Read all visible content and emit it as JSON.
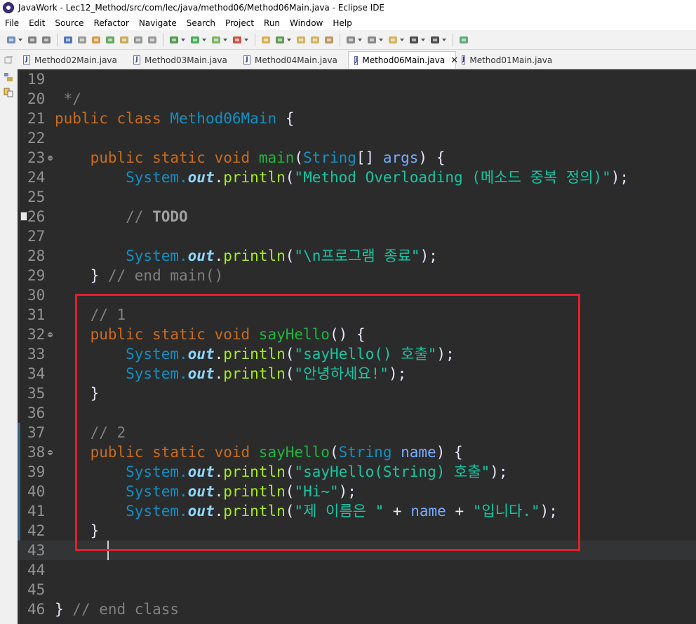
{
  "window": {
    "title": "JavaWork - Lec12_Method/src/com/lec/java/method06/Method06Main.java - Eclipse IDE"
  },
  "menu": [
    "File",
    "Edit",
    "Source",
    "Refactor",
    "Navigate",
    "Search",
    "Project",
    "Run",
    "Window",
    "Help"
  ],
  "toolbar_icons": [
    "new-icon",
    "save-icon",
    "save-all-icon",
    "terminal-icon",
    "skip-breakpoints-icon",
    "new-java-package-icon",
    "build-icon",
    "open-type-icon",
    "search-icon",
    "show-whitespace-icon",
    "debug-icon",
    "run-icon",
    "coverage-icon",
    "external-tools-icon",
    "new-class-icon",
    "refresh-icon",
    "open-folder-icon",
    "open-project-icon",
    "pen-icon",
    "next-annotation-icon",
    "prev-annotation-icon",
    "last-edit-icon",
    "back-icon",
    "forward-icon",
    "perspective-icon"
  ],
  "tabs": [
    {
      "label": "Method02Main.java",
      "active": false
    },
    {
      "label": "Method03Main.java",
      "active": false
    },
    {
      "label": "Method04Main.java",
      "active": false
    },
    {
      "label": "Method06Main.java",
      "active": true
    },
    {
      "label": "Method01Main.java",
      "active": false
    }
  ],
  "tab_close_glyph": "✕",
  "colors": {
    "editor_bg": "#2b2b2b",
    "keyword": "#cc6c1d",
    "class": "#1290c3",
    "string": "#17c6a3",
    "comment": "#808080",
    "method_decl": "#1eb540",
    "highlight_box": "#e0212a"
  },
  "editor": {
    "current_line": 43,
    "lines": [
      {
        "n": "19",
        "tokens": []
      },
      {
        "n": "20",
        "tokens": [
          {
            "t": " */",
            "c": "cm"
          }
        ]
      },
      {
        "n": "21",
        "tokens": [
          {
            "t": "public class ",
            "c": "kw"
          },
          {
            "t": "Method06Main",
            "c": "cls"
          },
          {
            "t": " {",
            "c": "pl"
          }
        ]
      },
      {
        "n": "22",
        "tokens": []
      },
      {
        "n": "23",
        "fold": true,
        "tokens": [
          {
            "t": "    public static void ",
            "c": "kw"
          },
          {
            "t": "main",
            "c": "mth"
          },
          {
            "t": "(",
            "c": "pl"
          },
          {
            "t": "String",
            "c": "cls"
          },
          {
            "t": "[] ",
            "c": "pl"
          },
          {
            "t": "args",
            "c": "prm"
          },
          {
            "t": ") {",
            "c": "pl"
          }
        ]
      },
      {
        "n": "24",
        "tokens": [
          {
            "t": "        System.",
            "c": "cls"
          },
          {
            "t": "out",
            "c": "fld"
          },
          {
            "t": ".",
            "c": "pl"
          },
          {
            "t": "println",
            "c": "callm"
          },
          {
            "t": "(",
            "c": "pl"
          },
          {
            "t": "\"Method Overloading (메소드 중복 정의)\"",
            "c": "str"
          },
          {
            "t": ");",
            "c": "pl"
          }
        ]
      },
      {
        "n": "25",
        "tokens": []
      },
      {
        "n": "26",
        "task": true,
        "tokens": [
          {
            "t": "        // ",
            "c": "cm"
          },
          {
            "t": "TODO",
            "c": "todo"
          }
        ]
      },
      {
        "n": "27",
        "tokens": []
      },
      {
        "n": "28",
        "tokens": [
          {
            "t": "        System.",
            "c": "cls"
          },
          {
            "t": "out",
            "c": "fld"
          },
          {
            "t": ".",
            "c": "pl"
          },
          {
            "t": "println",
            "c": "callm"
          },
          {
            "t": "(",
            "c": "pl"
          },
          {
            "t": "\"\\n프로그램 종료\"",
            "c": "str"
          },
          {
            "t": ");",
            "c": "pl"
          }
        ]
      },
      {
        "n": "29",
        "tokens": [
          {
            "t": "    } ",
            "c": "pl"
          },
          {
            "t": "// end main()",
            "c": "cm"
          }
        ]
      },
      {
        "n": "30",
        "tokens": []
      },
      {
        "n": "31",
        "tokens": [
          {
            "t": "    // 1",
            "c": "cm"
          }
        ]
      },
      {
        "n": "32",
        "fold": true,
        "tokens": [
          {
            "t": "    public static void ",
            "c": "kw"
          },
          {
            "t": "sayHello",
            "c": "mth"
          },
          {
            "t": "() {",
            "c": "pl"
          }
        ]
      },
      {
        "n": "33",
        "tokens": [
          {
            "t": "        System.",
            "c": "cls"
          },
          {
            "t": "out",
            "c": "fld"
          },
          {
            "t": ".",
            "c": "pl"
          },
          {
            "t": "println",
            "c": "callm"
          },
          {
            "t": "(",
            "c": "pl"
          },
          {
            "t": "\"sayHello() 호출\"",
            "c": "str"
          },
          {
            "t": ");",
            "c": "pl"
          }
        ]
      },
      {
        "n": "34",
        "tokens": [
          {
            "t": "        System.",
            "c": "cls"
          },
          {
            "t": "out",
            "c": "fld"
          },
          {
            "t": ".",
            "c": "pl"
          },
          {
            "t": "println",
            "c": "callm"
          },
          {
            "t": "(",
            "c": "pl"
          },
          {
            "t": "\"안녕하세요!\"",
            "c": "str"
          },
          {
            "t": ");",
            "c": "pl"
          }
        ]
      },
      {
        "n": "35",
        "tokens": [
          {
            "t": "    }",
            "c": "pl"
          }
        ]
      },
      {
        "n": "36",
        "tokens": []
      },
      {
        "n": "37",
        "tokens": [
          {
            "t": "    // 2",
            "c": "cm"
          }
        ]
      },
      {
        "n": "38",
        "fold": true,
        "tokens": [
          {
            "t": "    public static void ",
            "c": "kw"
          },
          {
            "t": "sayHello",
            "c": "mth"
          },
          {
            "t": "(",
            "c": "pl"
          },
          {
            "t": "String",
            "c": "cls"
          },
          {
            "t": " ",
            "c": "pl"
          },
          {
            "t": "name",
            "c": "prm"
          },
          {
            "t": ") {",
            "c": "pl"
          }
        ]
      },
      {
        "n": "39",
        "tokens": [
          {
            "t": "        System.",
            "c": "cls"
          },
          {
            "t": "out",
            "c": "fld"
          },
          {
            "t": ".",
            "c": "pl"
          },
          {
            "t": "println",
            "c": "callm"
          },
          {
            "t": "(",
            "c": "pl"
          },
          {
            "t": "\"sayHello(String) 호출\"",
            "c": "str"
          },
          {
            "t": ");",
            "c": "pl"
          }
        ]
      },
      {
        "n": "40",
        "tokens": [
          {
            "t": "        System.",
            "c": "cls"
          },
          {
            "t": "out",
            "c": "fld"
          },
          {
            "t": ".",
            "c": "pl"
          },
          {
            "t": "println",
            "c": "callm"
          },
          {
            "t": "(",
            "c": "pl"
          },
          {
            "t": "\"Hi~\"",
            "c": "str"
          },
          {
            "t": ");",
            "c": "pl"
          }
        ]
      },
      {
        "n": "41",
        "tokens": [
          {
            "t": "        System.",
            "c": "cls"
          },
          {
            "t": "out",
            "c": "fld"
          },
          {
            "t": ".",
            "c": "pl"
          },
          {
            "t": "println",
            "c": "callm"
          },
          {
            "t": "(",
            "c": "pl"
          },
          {
            "t": "\"제 이름은 \"",
            "c": "str"
          },
          {
            "t": " + ",
            "c": "pl"
          },
          {
            "t": "name",
            "c": "prm"
          },
          {
            "t": " + ",
            "c": "pl"
          },
          {
            "t": "\"입니다.\"",
            "c": "str"
          },
          {
            "t": ");",
            "c": "pl"
          }
        ]
      },
      {
        "n": "42",
        "tokens": [
          {
            "t": "    }",
            "c": "pl"
          }
        ]
      },
      {
        "n": "43",
        "tokens": []
      },
      {
        "n": "44",
        "tokens": []
      },
      {
        "n": "45",
        "tokens": []
      },
      {
        "n": "46",
        "tokens": [
          {
            "t": "} ",
            "c": "pl"
          },
          {
            "t": "// end class",
            "c": "cm"
          }
        ]
      }
    ]
  }
}
